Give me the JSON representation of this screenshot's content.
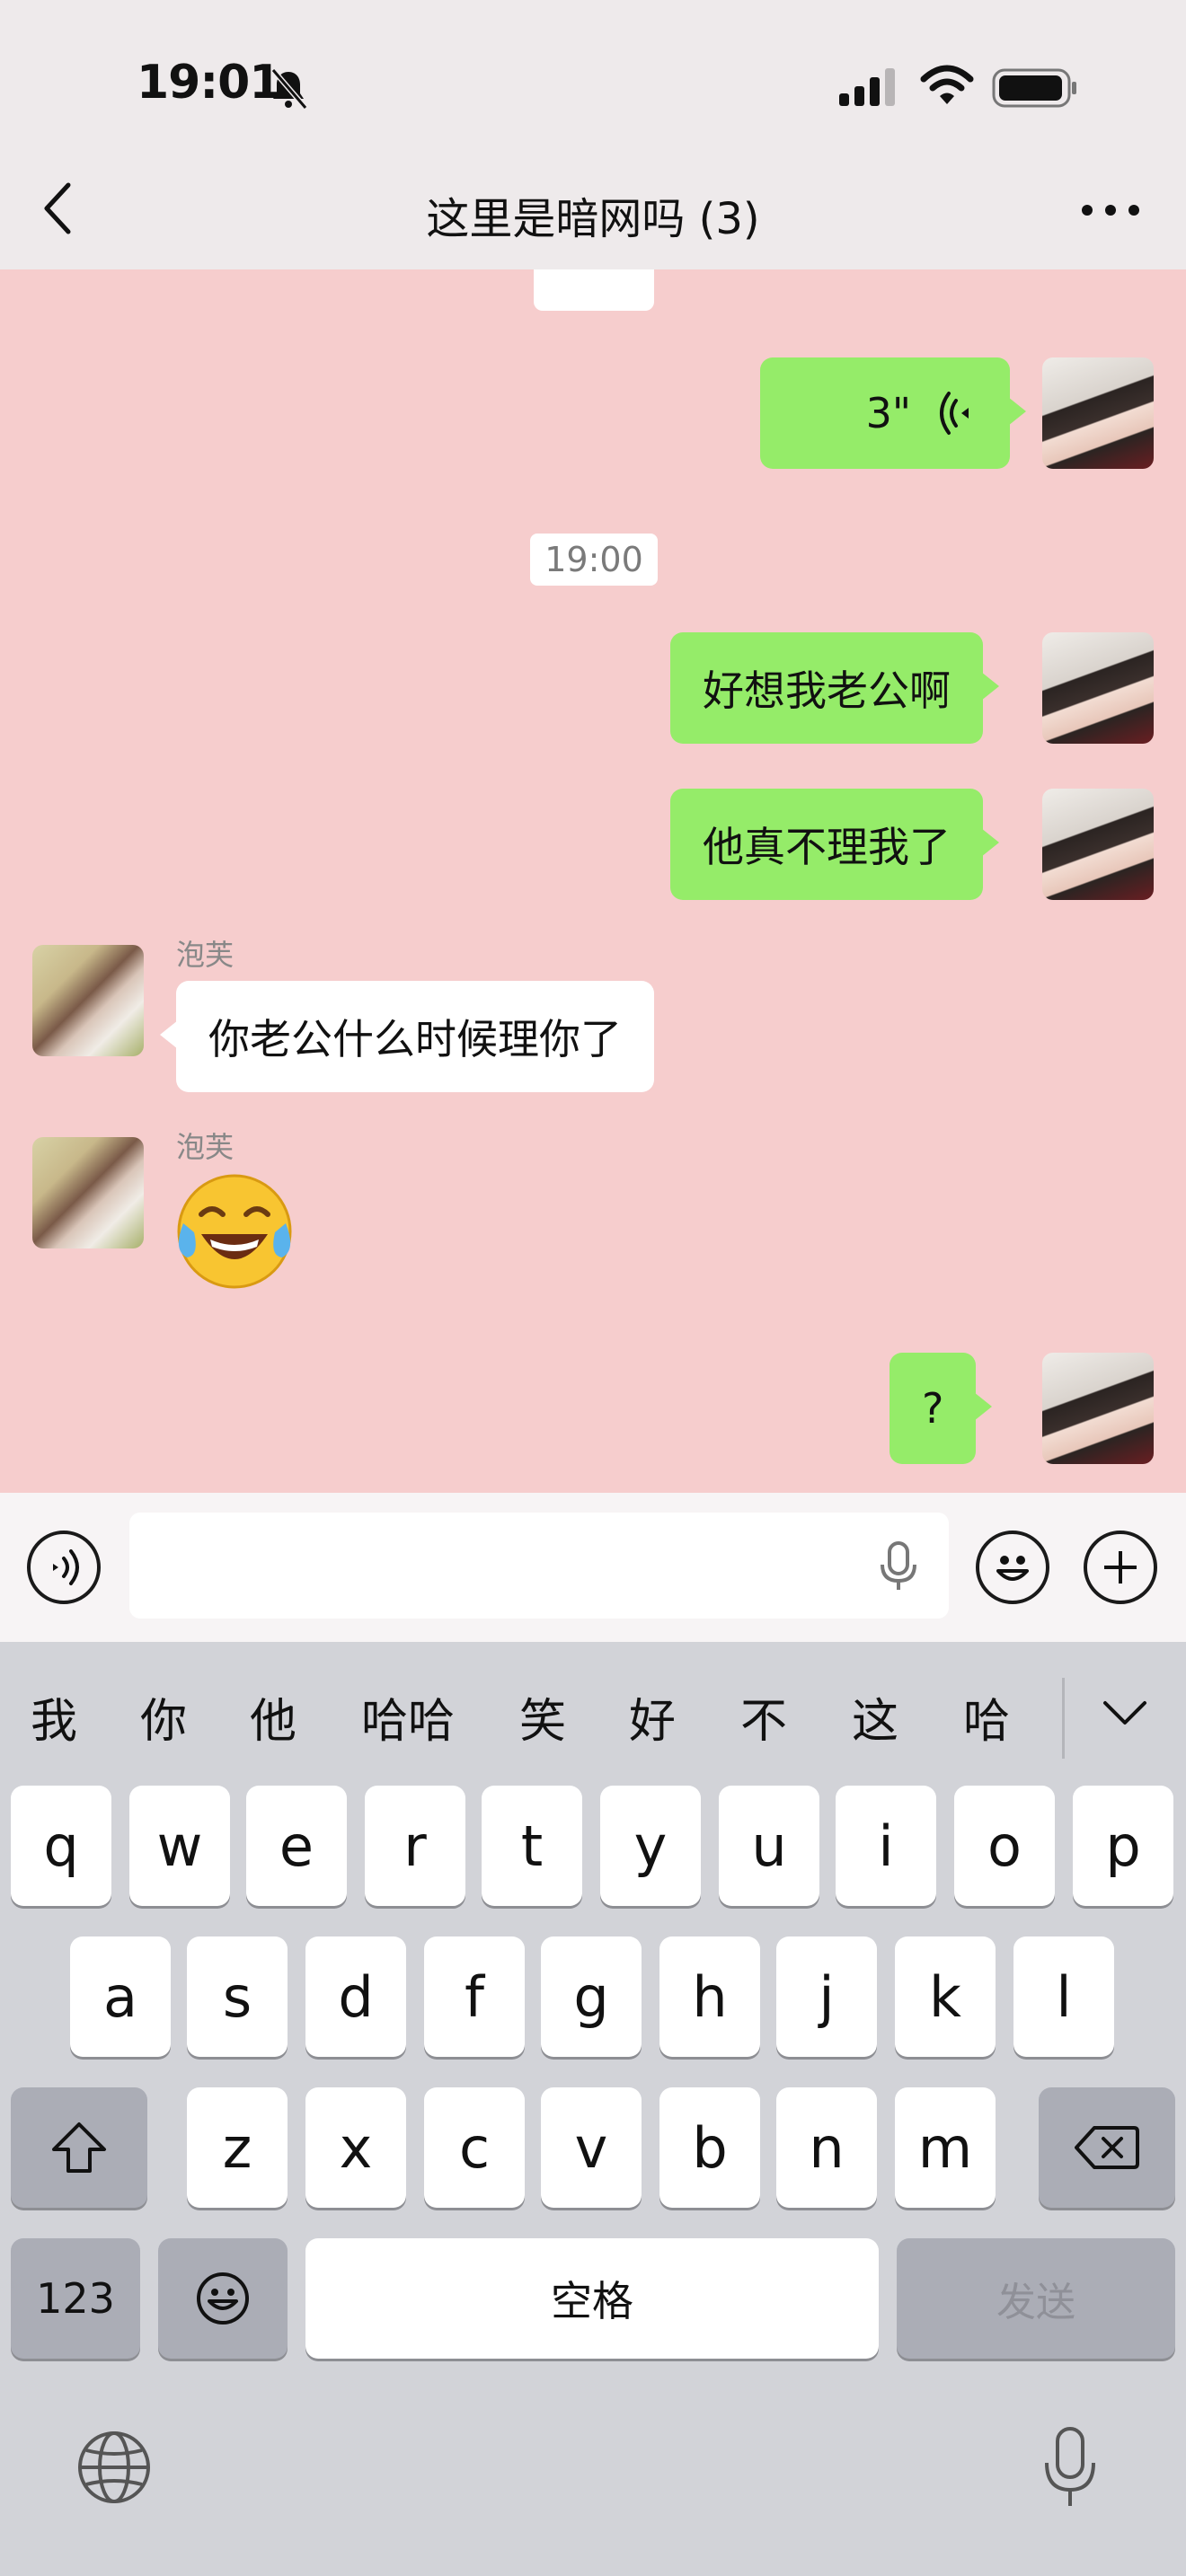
{
  "status_bar": {
    "time": "19:01"
  },
  "header": {
    "title": "这里是暗网吗 (3)"
  },
  "messages": {
    "voice_duration": "3\"",
    "timestamp": "19:00",
    "me_1": "好想我老公啊",
    "me_2": "他真不理我了",
    "sender_1": "泡芙",
    "her_1": "你老公什么时候理你了",
    "sender_2": "泡芙",
    "me_3": "?"
  },
  "keyboard": {
    "candidates": [
      "我",
      "你",
      "他",
      "哈哈",
      "笑",
      "好",
      "不",
      "这",
      "哈"
    ],
    "row1": [
      "q",
      "w",
      "e",
      "r",
      "t",
      "y",
      "u",
      "i",
      "o",
      "p"
    ],
    "row2": [
      "a",
      "s",
      "d",
      "f",
      "g",
      "h",
      "j",
      "k",
      "l"
    ],
    "row3": [
      "z",
      "x",
      "c",
      "v",
      "b",
      "n",
      "m"
    ],
    "numbers_label": "123",
    "space_label": "空格",
    "send_label": "发送"
  },
  "colors": {
    "chat_background": "#f6cdcd",
    "my_bubble": "#95ec69",
    "other_bubble": "#ffffff"
  }
}
